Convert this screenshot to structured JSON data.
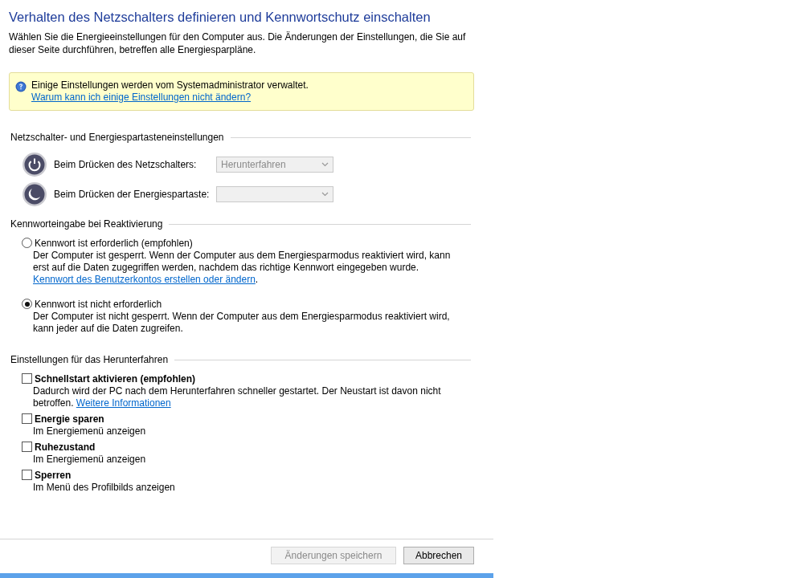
{
  "title": "Verhalten des Netzschalters definieren und Kennwortschutz einschalten",
  "intro": "Wählen Sie die Energieeinstellungen für den Computer aus. Die Änderungen der Einstellungen, die Sie auf dieser Seite durchführen, betreffen alle Energiesparpläne.",
  "notice": {
    "text": "Einige Einstellungen werden vom Systemadministrator verwaltet.",
    "link": "Warum kann ich einige Einstellungen nicht ändern?"
  },
  "power_section": {
    "heading": "Netzschalter- und Energiespartasteneinstellungen",
    "rows": [
      {
        "kind": "power",
        "label": "Beim Drücken des Netzschalters:",
        "value": "Herunterfahren",
        "disabled": true
      },
      {
        "kind": "sleep",
        "label": "Beim Drücken der Energiespartaste:",
        "disabled": true
      }
    ]
  },
  "password_section": {
    "heading": "Kennworteingabe bei Reaktivierung",
    "options": [
      {
        "label": "Kennwort ist erforderlich (empfohlen)",
        "selected": false,
        "description": "Der Computer ist gesperrt. Wenn der Computer aus dem Energiesparmodus reaktiviert wird, kann erst auf die Daten zugegriffen werden, nachdem das richtige Kennwort eingegeben wurde.",
        "link": "Kennwort des Benutzerkontos erstellen oder ändern",
        "link_suffix": "."
      },
      {
        "label": "Kennwort ist nicht erforderlich",
        "selected": true,
        "description": "Der Computer ist nicht gesperrt. Wenn der Computer aus dem Energiesparmodus reaktiviert wird, kann jeder auf die Daten zugreifen."
      }
    ]
  },
  "shutdown_section": {
    "heading": "Einstellungen für das Herunterfahren",
    "options": [
      {
        "label": "Schnellstart aktivieren (empfohlen)",
        "checked": false,
        "description": "Dadurch wird der PC nach dem Herunterfahren schneller gestartet. Der Neustart ist davon nicht betroffen.",
        "link": "Weitere Informationen"
      },
      {
        "label": "Energie sparen",
        "checked": false,
        "description": "Im Energiemenü anzeigen"
      },
      {
        "label": "Ruhezustand",
        "checked": false,
        "description": "Im Energiemenü anzeigen"
      },
      {
        "label": "Sperren",
        "checked": false,
        "description": "Im Menü des Profilbilds anzeigen"
      }
    ]
  },
  "buttons": [
    {
      "label": "Änderungen speichern",
      "disabled": true
    },
    {
      "label": "Abbrechen",
      "disabled": false
    }
  ]
}
